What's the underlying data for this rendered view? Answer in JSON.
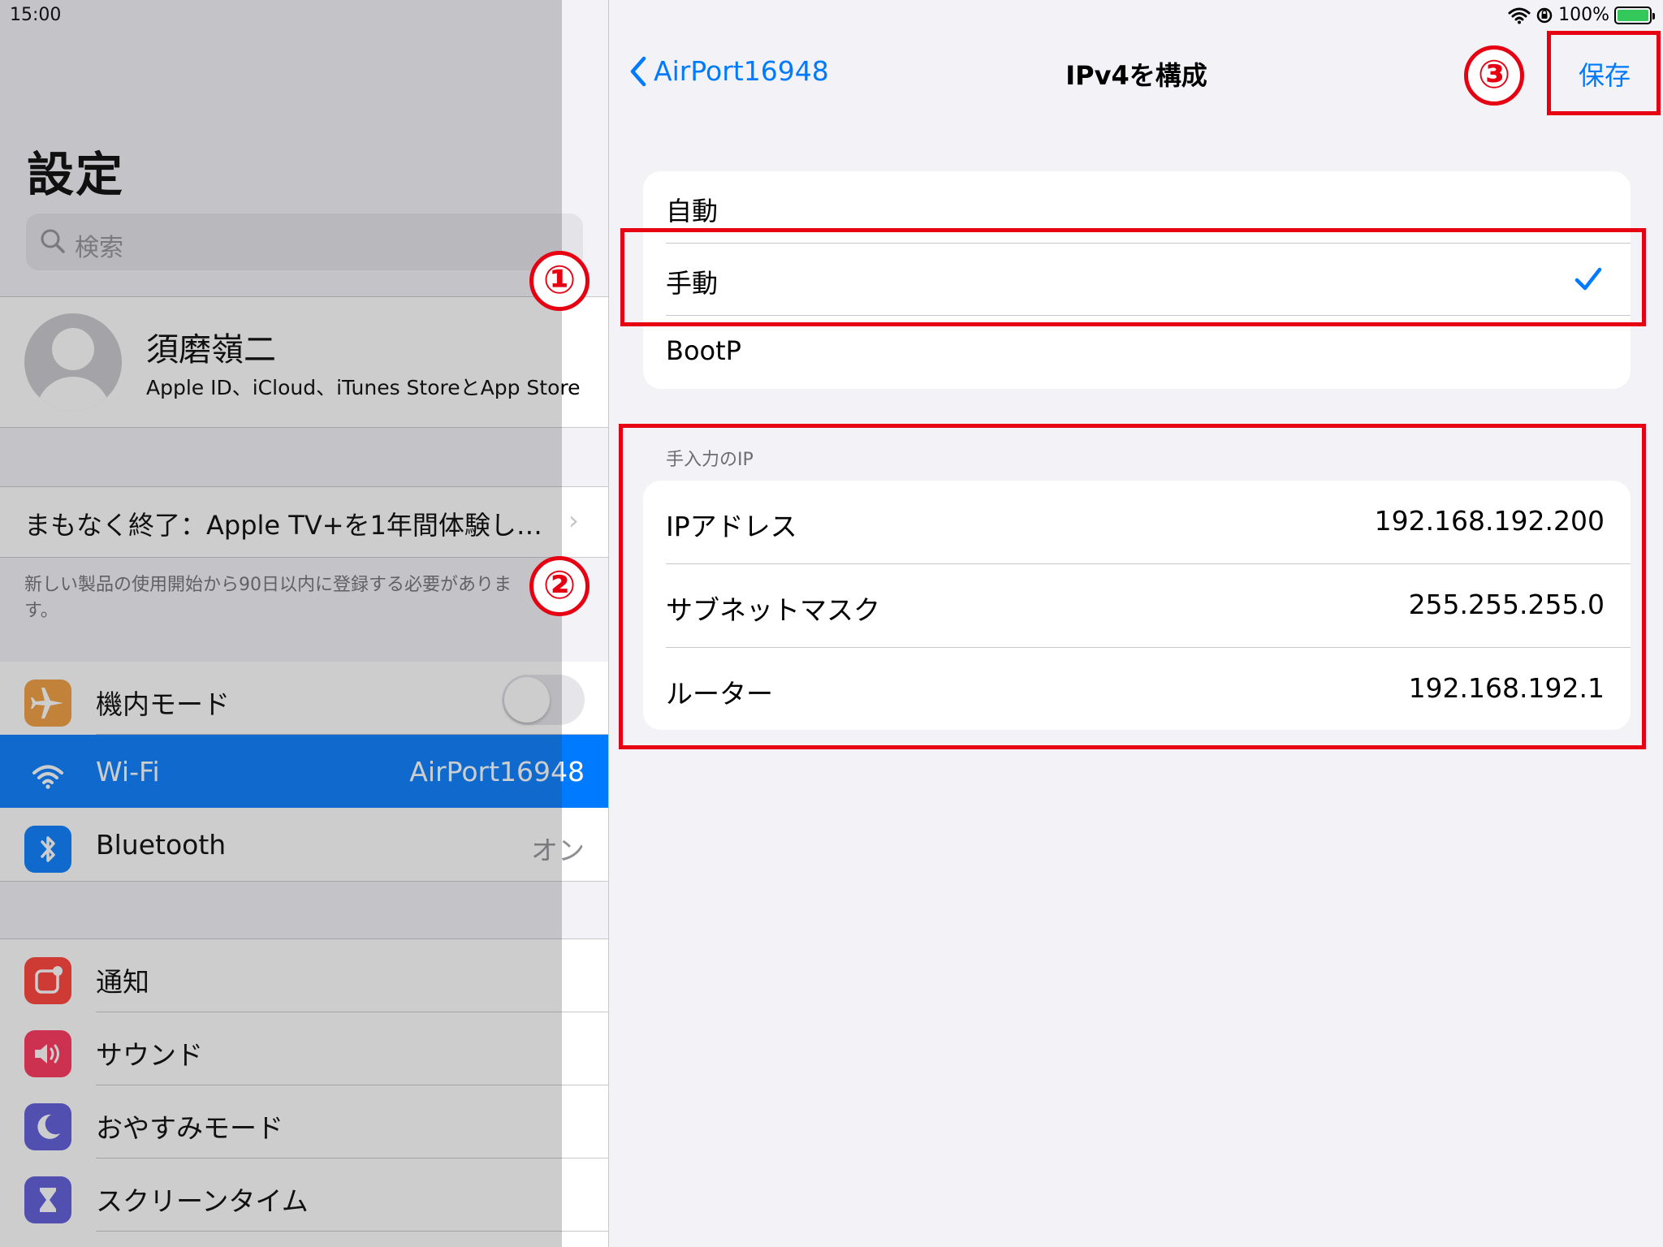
{
  "status_bar": {
    "time": "15:00",
    "battery": "100%"
  },
  "sidebar": {
    "title": "設定",
    "search_placeholder": "検索",
    "profile": {
      "name": "須磨嶺二",
      "subtitle": "Apple ID、iCloud、iTunes StoreとApp Store"
    },
    "promo": {
      "text": "まもなく終了：Apple TV+を1年間体験し…",
      "note": "新しい製品の使用開始から90日以内に登録する必要があります。"
    },
    "items": [
      {
        "label": "機内モード",
        "value": "",
        "icon": "airplane-icon",
        "color": "#f09a37"
      },
      {
        "label": "Wi-Fi",
        "value": "AirPort16948",
        "icon": "wifi-icon",
        "color": "#007aff"
      },
      {
        "label": "Bluetooth",
        "value": "オン",
        "icon": "bluetooth-icon",
        "color": "#007aff"
      },
      {
        "label": "通知",
        "value": "",
        "icon": "notification-icon",
        "color": "#ff3b30"
      },
      {
        "label": "サウンド",
        "value": "",
        "icon": "sound-icon",
        "color": "#ff2d55"
      },
      {
        "label": "おやすみモード",
        "value": "",
        "icon": "moon-icon",
        "color": "#5856d6"
      },
      {
        "label": "スクリーンタイム",
        "value": "",
        "icon": "hourglass-icon",
        "color": "#5856d6"
      }
    ]
  },
  "detail": {
    "nav": {
      "back_label": "AirPort16948",
      "title": "IPv4を構成",
      "save_label": "保存"
    },
    "options": [
      {
        "label": "自動",
        "checked": false
      },
      {
        "label": "手動",
        "checked": true
      },
      {
        "label": "BootP",
        "checked": false
      }
    ],
    "section_header": "手入力のIP",
    "fields": [
      {
        "label": "IPアドレス",
        "value": "192.168.192.200"
      },
      {
        "label": "サブネットマスク",
        "value": "255.255.255.0"
      },
      {
        "label": "ルーター",
        "value": "192.168.192.1"
      }
    ]
  },
  "annotations": {
    "marker1": "①",
    "marker2": "②",
    "marker3": "③",
    "color": "#e60012"
  }
}
